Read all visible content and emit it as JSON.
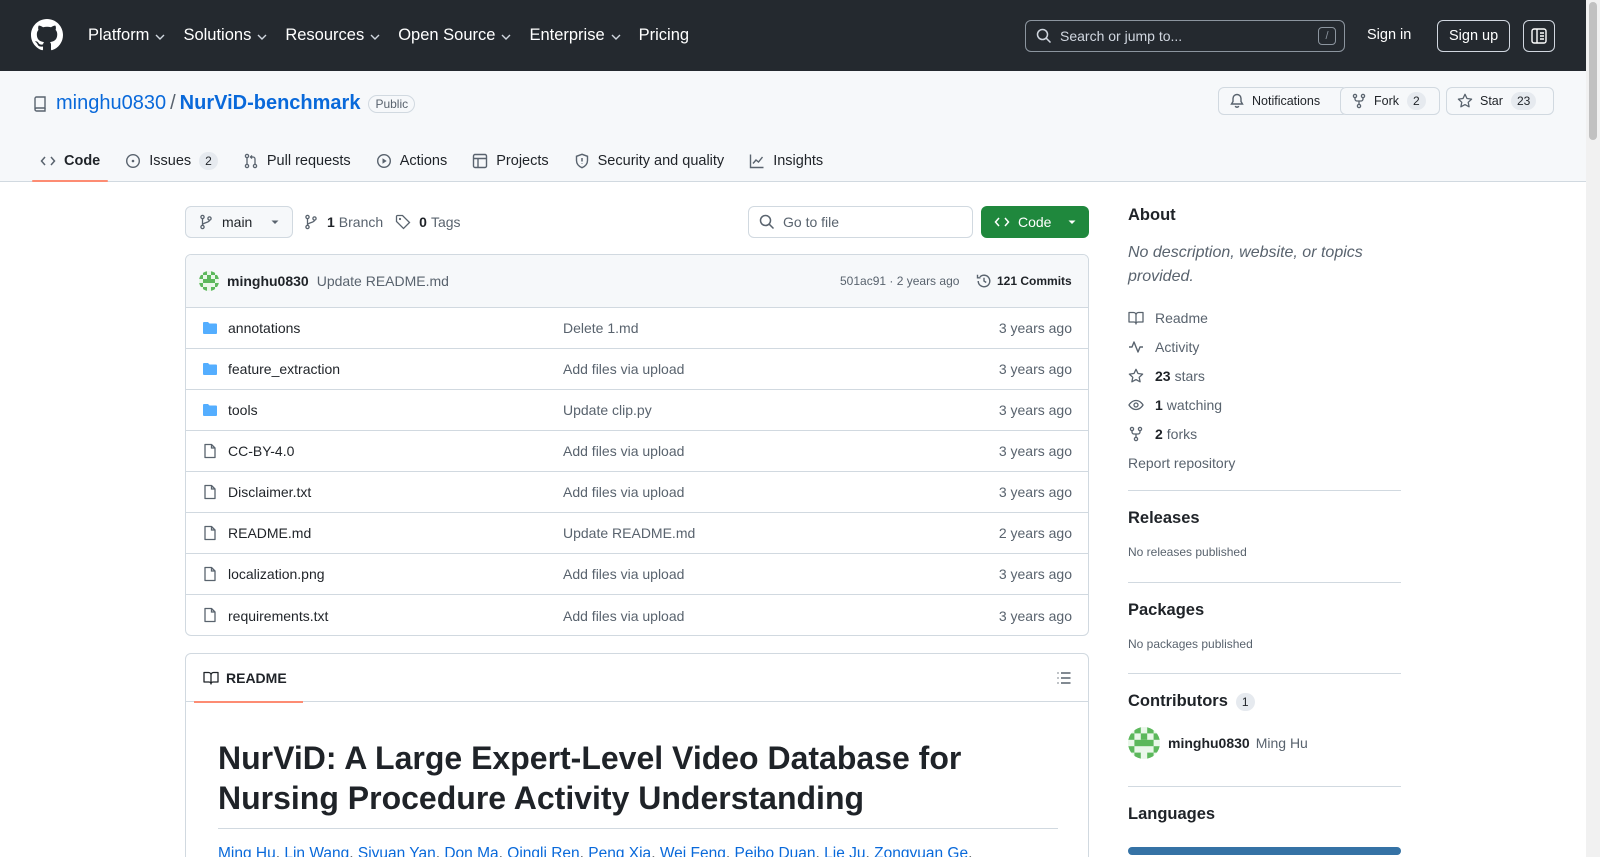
{
  "header": {
    "nav": [
      {
        "label": "Platform"
      },
      {
        "label": "Solutions"
      },
      {
        "label": "Resources"
      },
      {
        "label": "Open Source"
      },
      {
        "label": "Enterprise"
      },
      {
        "label": "Pricing"
      }
    ],
    "search_placeholder": "Search or jump to...",
    "search_shortcut": "/",
    "signin_label": "Sign in",
    "signup_label": "Sign up"
  },
  "repo": {
    "owner": "minghu0830",
    "separator": "/",
    "name": "NurViD-benchmark",
    "visibility": "Public",
    "notifications_label": "Notifications",
    "fork_label": "Fork",
    "fork_count": "2",
    "star_label": "Star",
    "star_count": "23"
  },
  "tabs": [
    {
      "label": "Code",
      "icon": "code-icon",
      "active": true
    },
    {
      "label": "Issues",
      "icon": "issue-icon",
      "count": "2"
    },
    {
      "label": "Pull requests",
      "icon": "pull-request-icon"
    },
    {
      "label": "Actions",
      "icon": "play-icon"
    },
    {
      "label": "Projects",
      "icon": "table-icon"
    },
    {
      "label": "Security and quality",
      "icon": "shield-icon"
    },
    {
      "label": "Insights",
      "icon": "graph-icon"
    }
  ],
  "controls": {
    "branch": "main",
    "branch_count": "1",
    "branch_label": "Branch",
    "tag_count": "0",
    "tag_label": "Tags",
    "goto_placeholder": "Go to file",
    "code_button": "Code"
  },
  "latest_commit": {
    "author": "minghu0830",
    "message": "Update README.md",
    "sha_time": "501ac91 · 2 years ago",
    "commits_label": "121 Commits"
  },
  "files": [
    {
      "name": "annotations",
      "type": "dir",
      "message": "Delete 1.md",
      "date": "3 years ago"
    },
    {
      "name": "feature_extraction",
      "type": "dir",
      "message": "Add files via upload",
      "date": "3 years ago"
    },
    {
      "name": "tools",
      "type": "dir",
      "message": "Update clip.py",
      "date": "3 years ago"
    },
    {
      "name": "CC-BY-4.0",
      "type": "file",
      "message": "Add files via upload",
      "date": "3 years ago"
    },
    {
      "name": "Disclaimer.txt",
      "type": "file",
      "message": "Add files via upload",
      "date": "3 years ago"
    },
    {
      "name": "README.md",
      "type": "file",
      "message": "Update README.md",
      "date": "2 years ago"
    },
    {
      "name": "localization.png",
      "type": "file",
      "message": "Add files via upload",
      "date": "3 years ago"
    },
    {
      "name": "requirements.txt",
      "type": "file",
      "message": "Add files via upload",
      "date": "3 years ago"
    }
  ],
  "readme": {
    "tab_label": "README",
    "title": "NurViD: A Large Expert-Level Video Database for Nursing Procedure Activity Understanding",
    "authors": [
      "Ming Hu",
      "Lin Wang",
      "Siyuan Yan",
      "Don Ma",
      "Qingli Ren",
      "Peng Xia",
      "Wei Feng",
      "Peibo Duan",
      "Lie Ju",
      "Zongyuan Ge"
    ]
  },
  "sidebar": {
    "about_heading": "About",
    "about_desc": "No description, website, or topics provided.",
    "readme_label": "Readme",
    "activity_label": "Activity",
    "stars_count": "23",
    "stars_label": "stars",
    "watching_count": "1",
    "watching_label": "watching",
    "forks_count": "2",
    "forks_label": "forks",
    "report_label": "Report repository",
    "releases_heading": "Releases",
    "releases_empty": "No releases published",
    "packages_heading": "Packages",
    "packages_empty": "No packages published",
    "contributors_heading": "Contributors",
    "contributors_count": "1",
    "contributor_login": "minghu0830",
    "contributor_name": "Ming Hu",
    "languages_heading": "Languages"
  },
  "colors": {
    "header_bg": "#24292f",
    "link": "#0969da",
    "primary_button": "#1f883d",
    "active_tab_underline": "#fd8c73",
    "folder": "#54aeff",
    "language_bar": "#3572a5"
  }
}
